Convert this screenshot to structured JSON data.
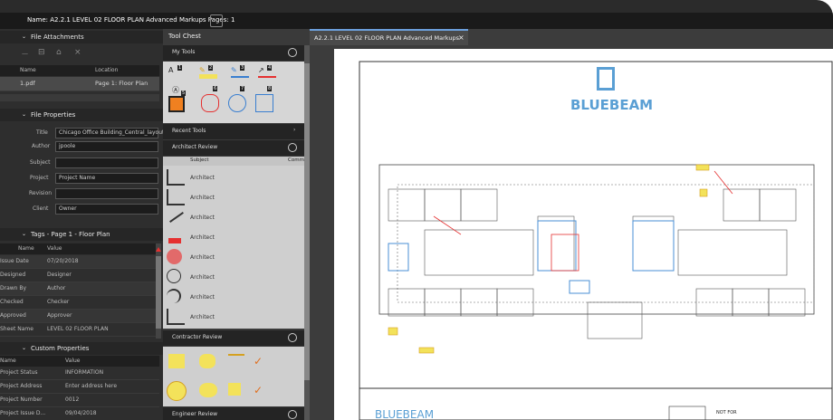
{
  "titlebar": {
    "text": "Name: A2.2.1 LEVEL 02 FLOOR PLAN Advanced Markups  Pages: 1"
  },
  "file_attachments": {
    "title": "File Attachments",
    "col_name": "Name",
    "col_location": "Location",
    "row_name": "1.pdf",
    "row_location": "Page 1: Floor Plan"
  },
  "file_properties": {
    "title": "File Properties",
    "fields": [
      {
        "label": "Title",
        "value": "Chicago Office Building_Central_layout"
      },
      {
        "label": "Author",
        "value": "jpoole"
      },
      {
        "label": "Subject",
        "value": ""
      },
      {
        "label": "Project",
        "value": "Project Name"
      },
      {
        "label": "Revision",
        "value": ""
      },
      {
        "label": "Client",
        "value": "Owner"
      }
    ]
  },
  "tags": {
    "title": "Tags - Page 1 - Floor Plan",
    "col_name": "Name",
    "col_value": "Value",
    "rows": [
      {
        "name": "Issue Date",
        "value": "07/20/2018"
      },
      {
        "name": "Designed",
        "value": "Designer"
      },
      {
        "name": "Drawn By",
        "value": "Author"
      },
      {
        "name": "Checked",
        "value": "Checker"
      },
      {
        "name": "Approved",
        "value": "Approver"
      },
      {
        "name": "Sheet Name",
        "value": "LEVEL 02 FLOOR PLAN"
      }
    ]
  },
  "custom_properties": {
    "title": "Custom Properties",
    "col_name": "Name",
    "col_value": "Value",
    "rows": [
      {
        "name": "Project Status",
        "value": "INFORMATION"
      },
      {
        "name": "Project Address",
        "value": "Enter address here"
      },
      {
        "name": "Project Number",
        "value": "0012"
      },
      {
        "name": "Project Issue D...",
        "value": "09/04/2018"
      }
    ]
  },
  "toolchest": {
    "title": "Tool Chest",
    "sections": {
      "my_tools": "My Tools",
      "recent_tools": "Recent Tools",
      "architect_review": "Architect Review",
      "contractor_review": "Contractor Review",
      "engineer_review": "Engineer Review"
    },
    "ar_col_subject": "Subject",
    "ar_col_comment": "Comm",
    "ar_label": "Architect",
    "my_tool_badges": [
      "1",
      "2",
      "3",
      "4",
      "5",
      "6",
      "7",
      "8"
    ]
  },
  "doc": {
    "tab_label": "A2.2.1 LEVEL 02 FLOOR PLAN Advanced Markups",
    "logo_text": "BLUEBEAM",
    "not_for": "NOT FOR"
  },
  "colors": {
    "accent": "#6ca0dc",
    "bluebeam": "#5a9fd4",
    "markup_red": "#e53030",
    "markup_yellow": "#f3e25a"
  }
}
